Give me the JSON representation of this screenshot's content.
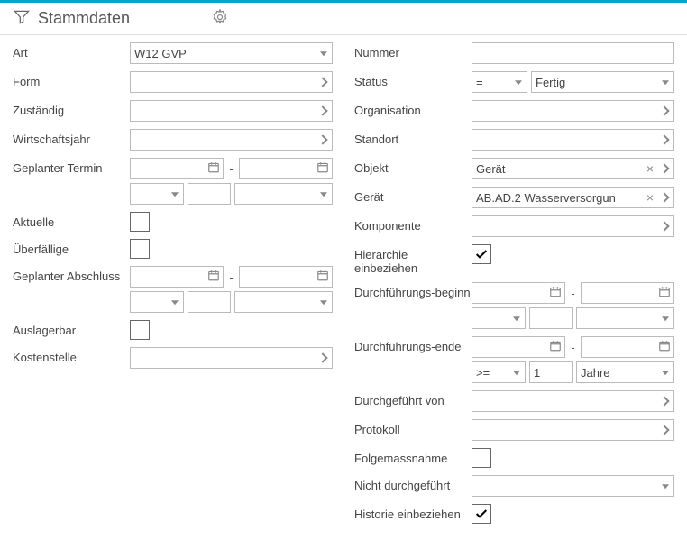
{
  "header": {
    "title": "Stammdaten"
  },
  "left": {
    "art": {
      "label": "Art",
      "value": "W12 GVP"
    },
    "form": {
      "label": "Form"
    },
    "zustaendig": {
      "label": "Zuständig"
    },
    "wirtschaftsjahr": {
      "label": "Wirtschaftsjahr"
    },
    "geplanterTermin": {
      "label": "Geplanter Termin"
    },
    "aktuelle": {
      "label": "Aktuelle"
    },
    "ueberfaellige": {
      "label": "Überfällige"
    },
    "geplanterAbschluss": {
      "label": "Geplanter Abschluss"
    },
    "auslagerbar": {
      "label": "Auslagerbar"
    },
    "kostenstelle": {
      "label": "Kostenstelle"
    }
  },
  "right": {
    "nummer": {
      "label": "Nummer"
    },
    "status": {
      "label": "Status",
      "op": "=",
      "value": "Fertig"
    },
    "organisation": {
      "label": "Organisation"
    },
    "standort": {
      "label": "Standort"
    },
    "objekt": {
      "label": "Objekt",
      "value": "Gerät"
    },
    "geraet": {
      "label": "Gerät",
      "value": "AB.AD.2 Wasserversorgun"
    },
    "komponente": {
      "label": "Komponente"
    },
    "hierarchie": {
      "label": "Hierarchie einbeziehen",
      "checked": true
    },
    "durchfBeginn": {
      "label": "Durchführungs-beginn"
    },
    "durchfEnde": {
      "label": "Durchführungs-ende",
      "op": ">=",
      "num": "1",
      "unit": "Jahre"
    },
    "durchfVon": {
      "label": "Durchgeführt von"
    },
    "protokoll": {
      "label": "Protokoll"
    },
    "folgemassnahme": {
      "label": "Folgemassnahme"
    },
    "nichtDurchgefuehrt": {
      "label": "Nicht durchgeführt"
    },
    "historie": {
      "label": "Historie einbeziehen",
      "checked": true
    }
  }
}
